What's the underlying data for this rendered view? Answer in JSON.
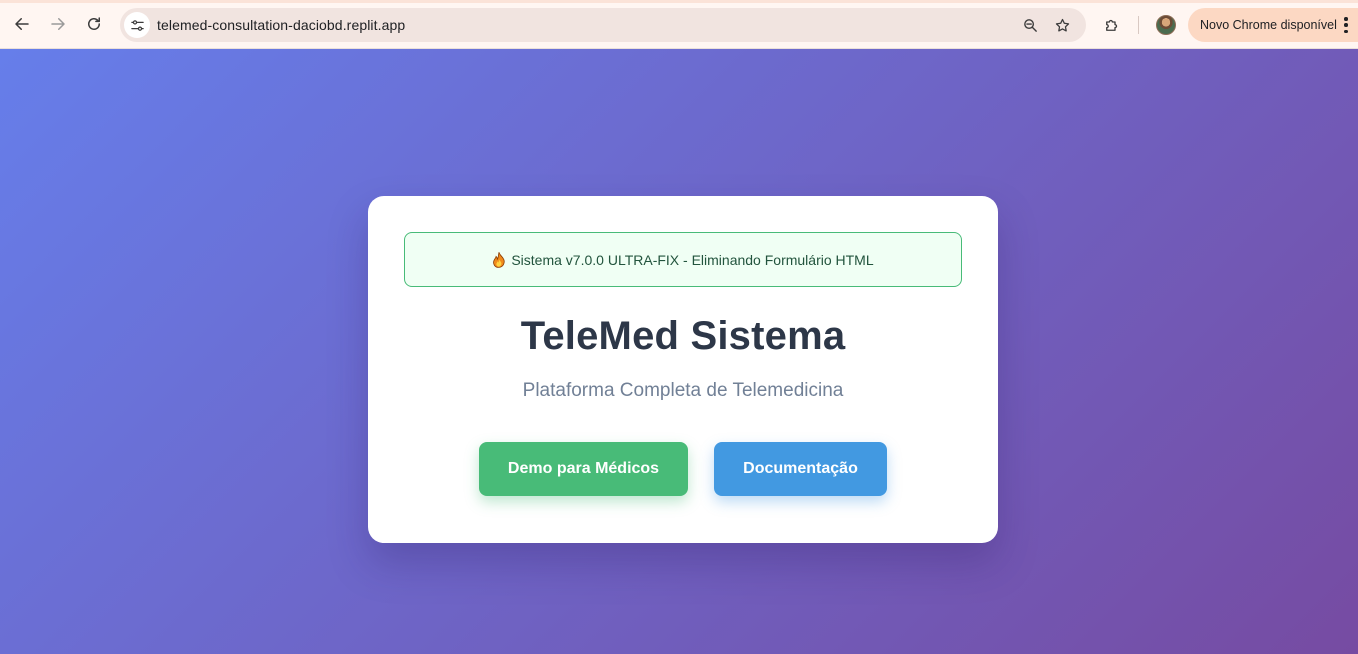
{
  "browser": {
    "url": "telemed-consultation-daciobd.replit.app",
    "update_label": "Novo Chrome disponível"
  },
  "banner": {
    "icon": "flame-icon",
    "text": "Sistema v7.0.0 ULTRA-FIX - Eliminando Formulário HTML"
  },
  "hero": {
    "title": "TeleMed Sistema",
    "subtitle": "Plataforma Completa de Telemedicina"
  },
  "actions": {
    "demo_label": "Demo para Médicos",
    "docs_label": "Documentação"
  },
  "colors": {
    "gradient_start": "#667eea",
    "gradient_end": "#764ba2",
    "demo_button": "#48bb78",
    "docs_button": "#4299e1",
    "banner_bg": "#f0fff4",
    "banner_border": "#48bb78"
  }
}
